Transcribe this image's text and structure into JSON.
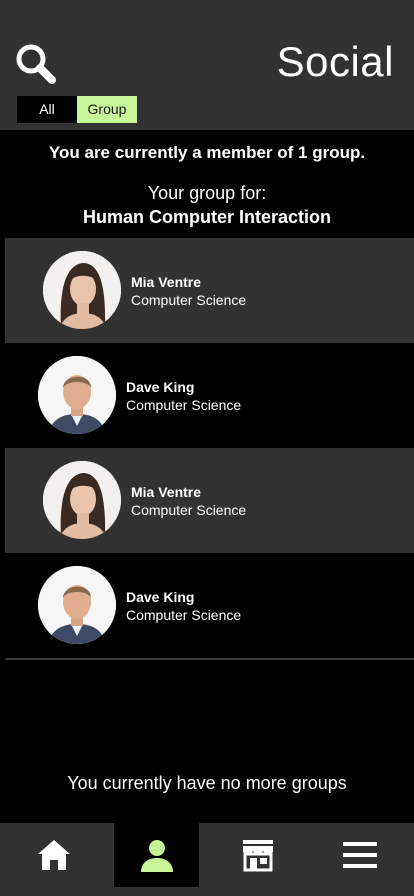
{
  "header": {
    "title": "Social"
  },
  "filter": {
    "all_label": "All",
    "group_label": "Group"
  },
  "summary": {
    "member_text": "You are currently a member of 1 group.",
    "group_for_label": "Your group for:",
    "group_name": "Human Computer Interaction"
  },
  "members": [
    {
      "name": "Mia Ventre",
      "department": "Computer Science"
    },
    {
      "name": "Dave King",
      "department": "Computer Science"
    },
    {
      "name": "Mia Ventre",
      "department": "Computer Science"
    },
    {
      "name": "Dave King",
      "department": "Computer Science"
    }
  ],
  "footer_message": "You currently have no more groups",
  "tabbar": {
    "active_tab": "profile",
    "tabs": [
      "home",
      "profile",
      "store",
      "menu"
    ]
  },
  "colors": {
    "header_bg": "#323232",
    "accent": "#c9f59a",
    "background": "#000000"
  }
}
